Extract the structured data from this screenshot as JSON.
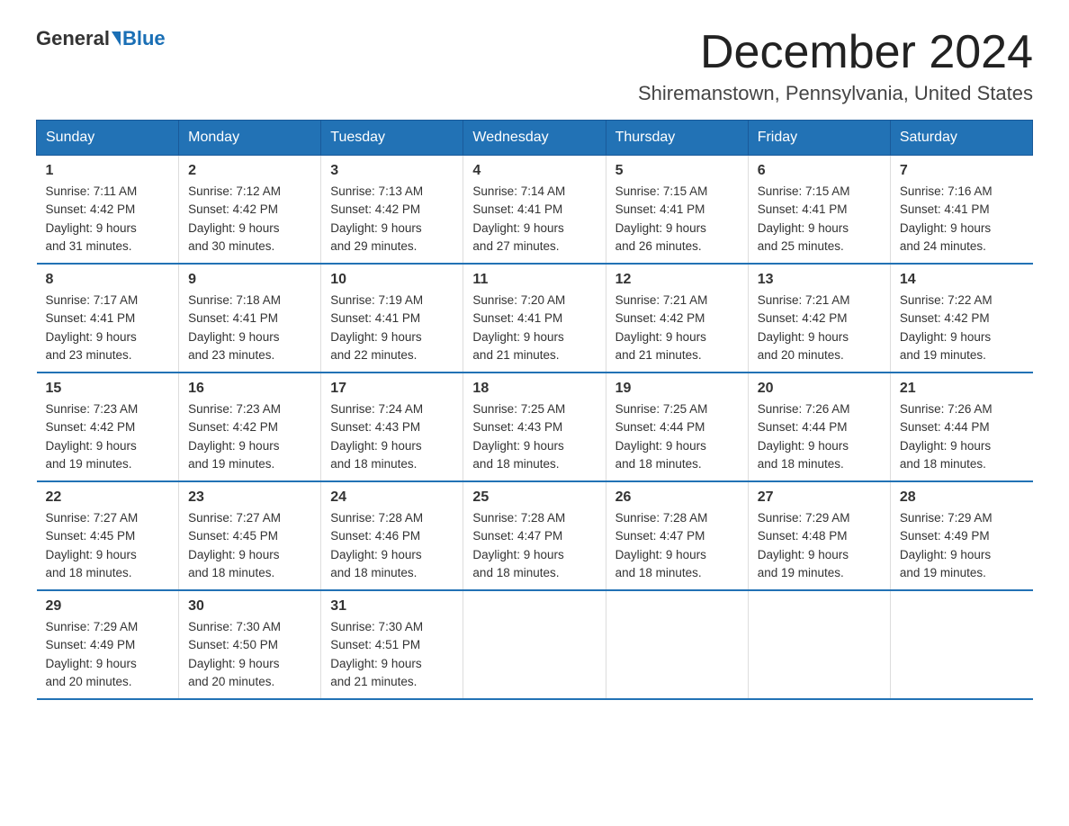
{
  "header": {
    "logo_general": "General",
    "logo_blue": "Blue",
    "title": "December 2024",
    "subtitle": "Shiremanstown, Pennsylvania, United States"
  },
  "weekdays": [
    "Sunday",
    "Monday",
    "Tuesday",
    "Wednesday",
    "Thursday",
    "Friday",
    "Saturday"
  ],
  "weeks": [
    [
      {
        "day": "1",
        "sunrise": "7:11 AM",
        "sunset": "4:42 PM",
        "daylight": "9 hours and 31 minutes."
      },
      {
        "day": "2",
        "sunrise": "7:12 AM",
        "sunset": "4:42 PM",
        "daylight": "9 hours and 30 minutes."
      },
      {
        "day": "3",
        "sunrise": "7:13 AM",
        "sunset": "4:42 PM",
        "daylight": "9 hours and 29 minutes."
      },
      {
        "day": "4",
        "sunrise": "7:14 AM",
        "sunset": "4:41 PM",
        "daylight": "9 hours and 27 minutes."
      },
      {
        "day": "5",
        "sunrise": "7:15 AM",
        "sunset": "4:41 PM",
        "daylight": "9 hours and 26 minutes."
      },
      {
        "day": "6",
        "sunrise": "7:15 AM",
        "sunset": "4:41 PM",
        "daylight": "9 hours and 25 minutes."
      },
      {
        "day": "7",
        "sunrise": "7:16 AM",
        "sunset": "4:41 PM",
        "daylight": "9 hours and 24 minutes."
      }
    ],
    [
      {
        "day": "8",
        "sunrise": "7:17 AM",
        "sunset": "4:41 PM",
        "daylight": "9 hours and 23 minutes."
      },
      {
        "day": "9",
        "sunrise": "7:18 AM",
        "sunset": "4:41 PM",
        "daylight": "9 hours and 23 minutes."
      },
      {
        "day": "10",
        "sunrise": "7:19 AM",
        "sunset": "4:41 PM",
        "daylight": "9 hours and 22 minutes."
      },
      {
        "day": "11",
        "sunrise": "7:20 AM",
        "sunset": "4:41 PM",
        "daylight": "9 hours and 21 minutes."
      },
      {
        "day": "12",
        "sunrise": "7:21 AM",
        "sunset": "4:42 PM",
        "daylight": "9 hours and 21 minutes."
      },
      {
        "day": "13",
        "sunrise": "7:21 AM",
        "sunset": "4:42 PM",
        "daylight": "9 hours and 20 minutes."
      },
      {
        "day": "14",
        "sunrise": "7:22 AM",
        "sunset": "4:42 PM",
        "daylight": "9 hours and 19 minutes."
      }
    ],
    [
      {
        "day": "15",
        "sunrise": "7:23 AM",
        "sunset": "4:42 PM",
        "daylight": "9 hours and 19 minutes."
      },
      {
        "day": "16",
        "sunrise": "7:23 AM",
        "sunset": "4:42 PM",
        "daylight": "9 hours and 19 minutes."
      },
      {
        "day": "17",
        "sunrise": "7:24 AM",
        "sunset": "4:43 PM",
        "daylight": "9 hours and 18 minutes."
      },
      {
        "day": "18",
        "sunrise": "7:25 AM",
        "sunset": "4:43 PM",
        "daylight": "9 hours and 18 minutes."
      },
      {
        "day": "19",
        "sunrise": "7:25 AM",
        "sunset": "4:44 PM",
        "daylight": "9 hours and 18 minutes."
      },
      {
        "day": "20",
        "sunrise": "7:26 AM",
        "sunset": "4:44 PM",
        "daylight": "9 hours and 18 minutes."
      },
      {
        "day": "21",
        "sunrise": "7:26 AM",
        "sunset": "4:44 PM",
        "daylight": "9 hours and 18 minutes."
      }
    ],
    [
      {
        "day": "22",
        "sunrise": "7:27 AM",
        "sunset": "4:45 PM",
        "daylight": "9 hours and 18 minutes."
      },
      {
        "day": "23",
        "sunrise": "7:27 AM",
        "sunset": "4:45 PM",
        "daylight": "9 hours and 18 minutes."
      },
      {
        "day": "24",
        "sunrise": "7:28 AM",
        "sunset": "4:46 PM",
        "daylight": "9 hours and 18 minutes."
      },
      {
        "day": "25",
        "sunrise": "7:28 AM",
        "sunset": "4:47 PM",
        "daylight": "9 hours and 18 minutes."
      },
      {
        "day": "26",
        "sunrise": "7:28 AM",
        "sunset": "4:47 PM",
        "daylight": "9 hours and 18 minutes."
      },
      {
        "day": "27",
        "sunrise": "7:29 AM",
        "sunset": "4:48 PM",
        "daylight": "9 hours and 19 minutes."
      },
      {
        "day": "28",
        "sunrise": "7:29 AM",
        "sunset": "4:49 PM",
        "daylight": "9 hours and 19 minutes."
      }
    ],
    [
      {
        "day": "29",
        "sunrise": "7:29 AM",
        "sunset": "4:49 PM",
        "daylight": "9 hours and 20 minutes."
      },
      {
        "day": "30",
        "sunrise": "7:30 AM",
        "sunset": "4:50 PM",
        "daylight": "9 hours and 20 minutes."
      },
      {
        "day": "31",
        "sunrise": "7:30 AM",
        "sunset": "4:51 PM",
        "daylight": "9 hours and 21 minutes."
      },
      null,
      null,
      null,
      null
    ]
  ],
  "labels": {
    "sunrise": "Sunrise:",
    "sunset": "Sunset:",
    "daylight": "Daylight:"
  }
}
